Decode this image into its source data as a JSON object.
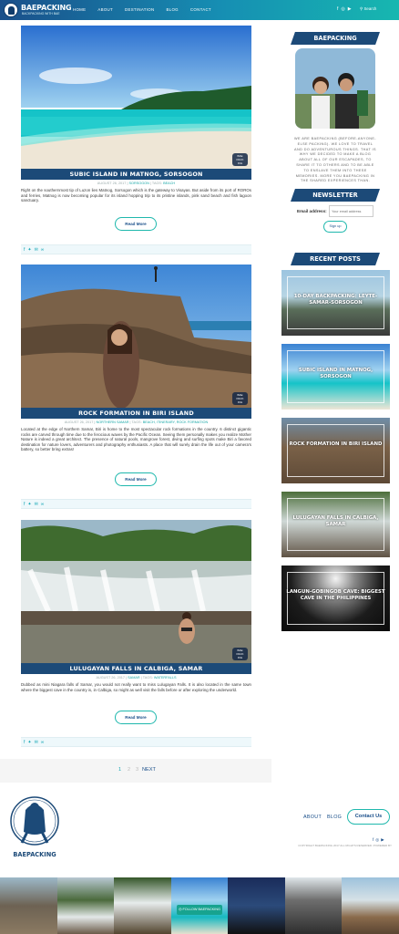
{
  "header": {
    "logo_title": "BAEPACKING",
    "logo_sub": "BACKPACKING WITH BAE",
    "nav": [
      "HOME",
      "ABOUT",
      "DESTINATION",
      "BLOG",
      "CONTACT"
    ],
    "social_icons": [
      "facebook-icon",
      "instagram-icon",
      "youtube-icon"
    ],
    "search_label": "Search"
  },
  "posts": [
    {
      "title": "SUBIC ISLAND IN MATNOG, SORSOGON",
      "date": "AUGUST 26, 2017",
      "category": "SORSOGON",
      "tags_label": "TAGS:",
      "tags": "BEACH",
      "excerpt": "Right on the southernmost tip of Luzon lies Matnog, Sorsogon which is the gateway to Visayas. But aside from its port of ROROs and ferries, Matnog is now becoming popular for its island hopping trip to its pristine islands, pink sand beach and fish lagoon sanctuary.",
      "read_more": "Read More"
    },
    {
      "title": "ROCK FORMATION IN BIRI ISLAND",
      "date": "AUGUST 26, 2017",
      "category": "NORTHERN SAMAR",
      "tags_label": "TAGS:",
      "tags": "BEACH, ITINERARY, ROCK FORMATION",
      "excerpt": "Located at the edge of Northern Samar, Biri is home to the most spectacular rock formations in the country. 6 distinct gigantic rocks are carved through time due to the ferocious waves by the Pacific Ocean. Seeing them personally makes you realize Mother Nature is indeed a great architect. The presence of natural pools, mangrove forest, diving and surfing spots make Biri a favored destination for nature lovers, adventurers and photography enthusiasts. A place that will surely drain the life out of your camera's battery, so better bring extras!",
      "read_more": "Read More"
    },
    {
      "title": "LULUGAYAN FALLS IN CALBIGA, SAMAR",
      "date": "AUGUST 26, 2017",
      "category": "SAMAR",
      "tags_label": "TAGS:",
      "tags": "WATERFALLS",
      "excerpt": "Dubbed as mini Niagara falls of Samar, you would not really want to miss Lulugayan Falls. It is also located in the same town where the biggest cave in the country is, in Calbiga, so might as well visit the falls before or after exploring the underworld.",
      "read_more": "Read More"
    }
  ],
  "share_icons": [
    "facebook-icon",
    "twitter-icon",
    "email-icon",
    "link-icon"
  ],
  "pagination": {
    "pages": [
      "1",
      "2",
      "3"
    ],
    "next": "NEXT",
    "current": "1"
  },
  "sidebar": {
    "about_heading": "BAEPACKING",
    "about_text": "WE ARE BAEPACKING (BEFORE-ANYONE-ELSE PACKING). WE LOVE TO TRAVEL AND DO ADVENTUROUS THINGS. THAT IS WHY WE DECIDED TO MAKE A BLOG ABOUT ALL OF OUR ESCAPADES, TO SHARE IT TO OTHERS AND TO BE ABLE TO ENSLAVE THEM INTO THESE MEMORIES. MORE YOU BAEPACKING IN THE SHARED EXPERIENCES THAN.",
    "newsletter_heading": "NEWSLETTER",
    "email_label": "Email address:",
    "email_placeholder": "Your email address",
    "signup": "Sign up",
    "recent_heading": "RECENT POSTS",
    "recent_posts": [
      "10-DAY BACKPACKING: LEYTE-SAMAR-SORSOGON",
      "SUBIC ISLAND IN MATNOG, SORSOGON",
      "ROCK FORMATION IN BIRI ISLAND",
      "LULUGAYAN FALLS IN CALBIGA, SAMAR",
      "LANGUN-GOBINGOB CAVE: BIGGEST CAVE IN THE PHILIPPINES"
    ]
  },
  "footer": {
    "logo_text": "BAEPACKING",
    "nav": [
      "ABOUT",
      "BLOG"
    ],
    "contact": "Contact Us",
    "social_icons": [
      "facebook-icon",
      "instagram-icon",
      "youtube-icon"
    ],
    "copyright": "COPYRIGHT BAEPACKING 2017 ALL RIGHTS RESERVED. POWERED BY",
    "follow": "FOLLOW BAEPACKING"
  }
}
